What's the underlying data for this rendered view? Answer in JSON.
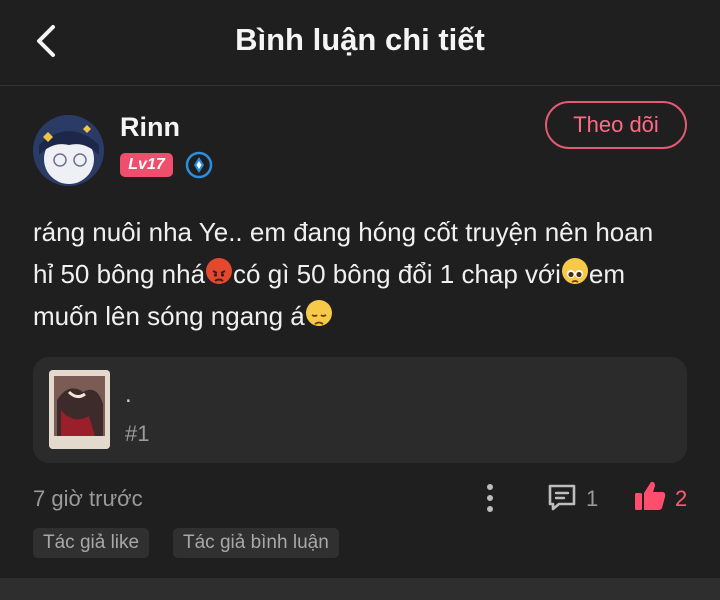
{
  "header": {
    "title": "Bình luận chi tiết",
    "back_icon": "chevron-left-icon"
  },
  "comment": {
    "username": "Rinn",
    "level": "Lv17",
    "follow_label": "Theo dõi",
    "text": [
      "ráng nuôi nha Ye.. em đang hóng cốt truyện nên hoan",
      "hỉ 50 bông nhá",
      "có gì 50 bông đổi 1 chap với",
      "em",
      "muốn lên sóng ngang á"
    ],
    "emojis": [
      "angry-face-emoji",
      "pleading-face-emoji",
      "disappointed-face-emoji"
    ],
    "quote": {
      "text": ".",
      "number": "#1"
    },
    "time": "7 giờ trước",
    "comment_count": "1",
    "like_count": "2",
    "tags": [
      "Tác giả like",
      "Tác giả bình luận"
    ]
  },
  "colors": {
    "accent": "#ef4f6c",
    "background": "#1f1f1f"
  }
}
